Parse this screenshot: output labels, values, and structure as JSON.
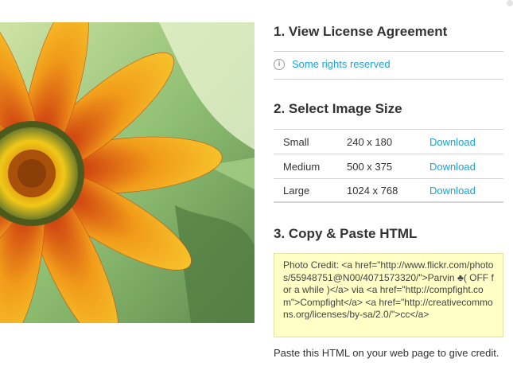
{
  "photo": {
    "alt_label": "orange gazania flower",
    "accent": "#f19b1a"
  },
  "section1": {
    "title": "1. View License Agreement",
    "rights_link": "Some rights reserved"
  },
  "section2": {
    "title": "2. Select Image Size",
    "sizes": [
      {
        "name": "Small",
        "dims": "240 x 180",
        "action": "Download"
      },
      {
        "name": "Medium",
        "dims": "500 x 375",
        "action": "Download"
      },
      {
        "name": "Large",
        "dims": "1024 x 768",
        "action": "Download"
      }
    ]
  },
  "section3": {
    "title": "3. Copy & Paste HTML",
    "code": "Photo Credit: <a href=\"http://www.flickr.com/photos/55948751@N00/4071573320/\">Parvin ♣( OFF for a while )</a> via <a href=\"http://compfight.com\">Compfight</a> <a href=\"http://creativecommons.org/licenses/by-sa/2.0/\">cc</a>",
    "note": "Paste this HTML on your web page to give credit."
  },
  "colors": {
    "link": "#1aa3d7",
    "code_bg": "#ffffc6",
    "rule": "#cfcfcf"
  }
}
